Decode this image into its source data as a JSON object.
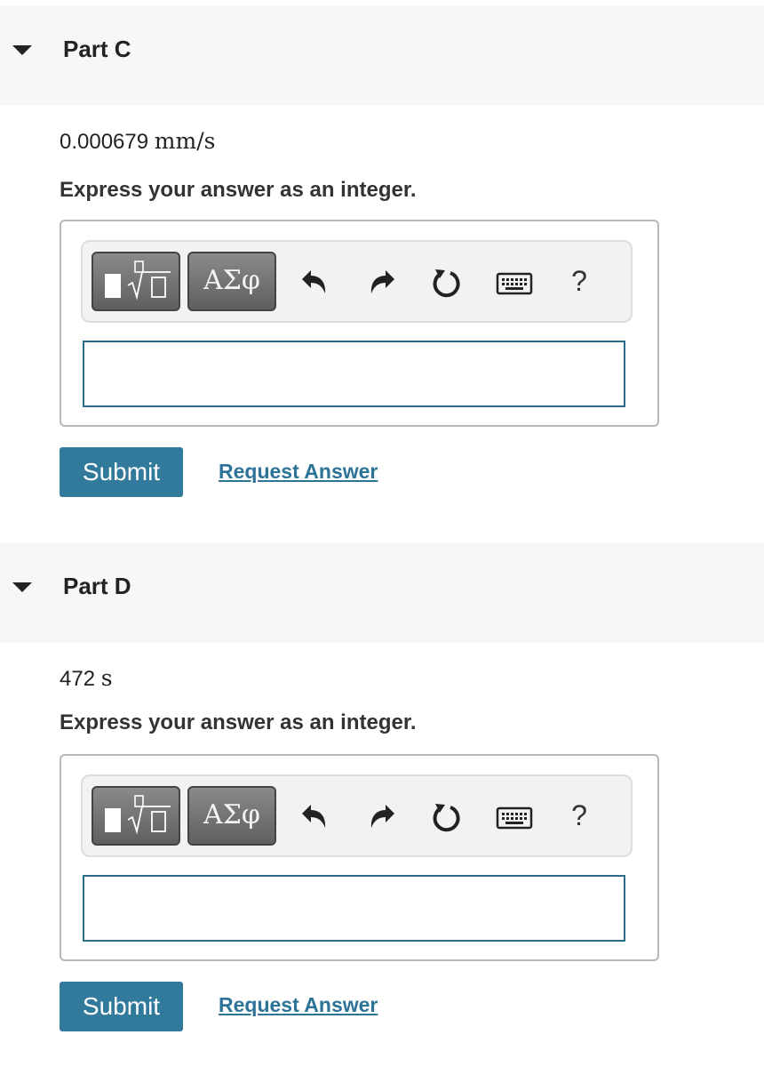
{
  "parts": [
    {
      "title": "Part C",
      "given_value": "0.000679",
      "given_unit": "mm/s",
      "instruction": "Express your answer as an integer.",
      "input_value": "",
      "submit_label": "Submit",
      "request_label": "Request Answer"
    },
    {
      "title": "Part D",
      "given_value": "472",
      "given_unit": "s",
      "instruction": "Express your answer as an integer.",
      "input_value": "",
      "submit_label": "Submit",
      "request_label": "Request Answer"
    }
  ],
  "toolbar": {
    "greek_label": "ΑΣφ",
    "help_label": "?",
    "icons": [
      "templates-icon",
      "undo-icon",
      "redo-icon",
      "reset-icon",
      "keyboard-icon",
      "help-icon"
    ]
  },
  "colors": {
    "header_bg": "#f7f7f7",
    "submit_bg": "#327a9c",
    "link": "#2d7397",
    "input_border": "#2f6b8a"
  }
}
